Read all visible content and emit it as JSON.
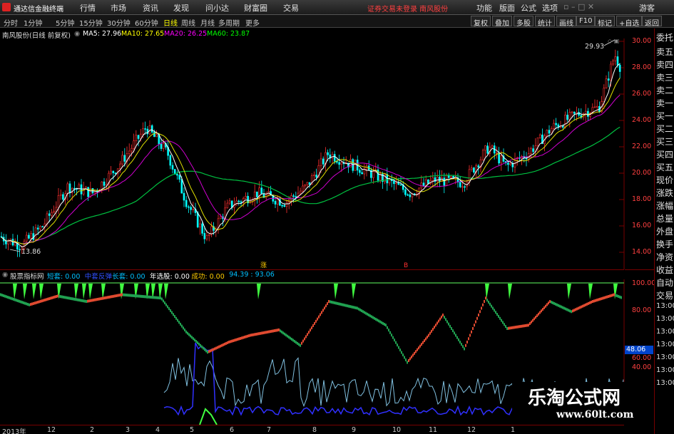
{
  "app": {
    "title": "通达信金融终端",
    "status_message": "证券交易未登录  南风股份",
    "menu": [
      "行情",
      "市场",
      "资讯",
      "发现",
      "问小达",
      "财富圈",
      "交易"
    ],
    "right_menu": [
      "功能",
      "版面",
      "公式",
      "选项",
      "游客"
    ]
  },
  "toolbar": {
    "periods": [
      "分时",
      "1分钟",
      "5分钟",
      "15分钟",
      "30分钟",
      "60分钟",
      "日线",
      "周线",
      "月线",
      "多周期",
      "更多"
    ],
    "active_period": "日线",
    "right_buttons": [
      "复权",
      "叠加",
      "多股",
      "统计",
      "画线",
      "F10",
      "标记",
      "+自选",
      "返回"
    ]
  },
  "info": {
    "stock": "南风股份(日线 前复权)",
    "ma5": "MA5: 27.96",
    "ma10": "MA10: 27.65",
    "ma20": "MA20: 26.25",
    "ma60": "MA60: 23.87"
  },
  "annotations": {
    "high": "29.93",
    "low": "13.86"
  },
  "price_axis": [
    "30.00",
    "28.00",
    "26.00",
    "24.00",
    "22.00",
    "20.00",
    "18.00",
    "16.00",
    "14.00"
  ],
  "indicator": {
    "name": "股票指标网",
    "fields": [
      {
        "text": "短套: 0.00",
        "color": "#00c0ff"
      },
      {
        "text": "中套",
        "color": "#3050ff"
      },
      {
        "text": "反弹",
        "color": "#3050ff"
      },
      {
        "text": "长套: 0.00",
        "color": "#00c0ff"
      },
      {
        "text": "年选股: 0.00",
        "color": "#ffffff"
      },
      {
        "text": "成功: 0.00",
        "color": "#ffcc00"
      },
      {
        "text": "94.39 : 93.06",
        "color": "#00c0ff"
      }
    ],
    "axis": [
      "100.00",
      "80.00",
      "60.00",
      "40.00"
    ],
    "current_value": "48.06"
  },
  "right_panel": [
    "委托",
    "卖五",
    "卖四",
    "卖三",
    "卖二",
    "卖一",
    "买一",
    "买二",
    "买三",
    "买四",
    "买五",
    "现价",
    "涨跌",
    "涨幅",
    "总量",
    "外盘",
    "换手",
    "净资",
    "收益",
    "自动",
    "交易",
    "13:00",
    "13:00",
    "13:00",
    "13:00",
    "13:00",
    "13:00",
    "13:00"
  ],
  "time_axis": [
    "2013年",
    "12",
    "2",
    "3",
    "4",
    "5",
    "6",
    "7",
    "8",
    "9",
    "10",
    "11",
    "12",
    "1"
  ],
  "markers": {
    "left": "涨",
    "right": "B"
  },
  "watermark": {
    "title": "乐淘公式网",
    "url": "www.60lt.com"
  },
  "colors": {
    "up": "#ff3030",
    "down": "#00ff60",
    "ma5": "#ffffff",
    "ma10": "#ffff00",
    "ma20": "#ff00ff",
    "ma60": "#00ff00"
  }
}
